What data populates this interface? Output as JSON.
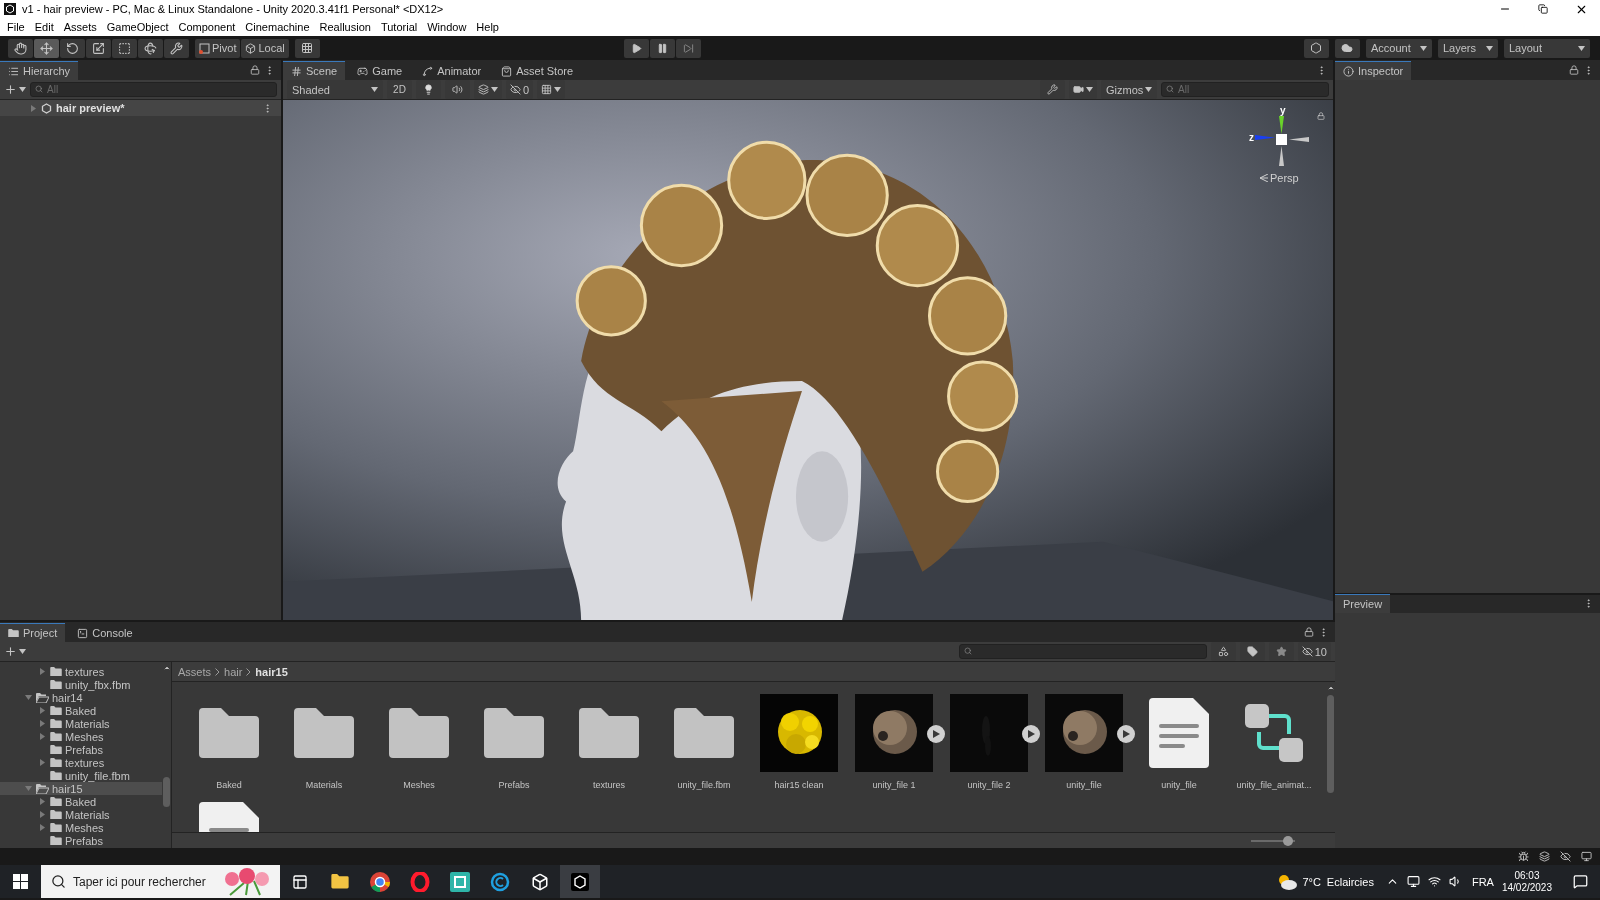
{
  "window": {
    "title": "v1 - hair preview - PC, Mac & Linux Standalone - Unity 2020.3.41f1 Personal* <DX12>"
  },
  "menu": [
    "File",
    "Edit",
    "Assets",
    "GameObject",
    "Component",
    "Cinemachine",
    "Reallusion",
    "Tutorial",
    "Window",
    "Help"
  ],
  "toolbar": {
    "tools": [
      {
        "kind": "hand",
        "selected": false
      },
      {
        "kind": "move",
        "selected": true
      },
      {
        "kind": "rotate",
        "selected": false
      },
      {
        "kind": "scale",
        "selected": false
      },
      {
        "kind": "rect",
        "selected": false
      },
      {
        "kind": "transform",
        "selected": false
      },
      {
        "kind": "custom",
        "selected": false
      }
    ],
    "pivot": "Pivot",
    "space": "Local",
    "dropdowns": [
      "Account",
      "Layers",
      "Layout"
    ]
  },
  "hierarchy": {
    "title": "Hierarchy",
    "search": {
      "placeholder": "All"
    },
    "items": [
      {
        "label": "hair preview*",
        "expanded": false
      }
    ]
  },
  "scene": {
    "tabs": [
      {
        "kind": "scene",
        "label": "Scene",
        "selected": true
      },
      {
        "kind": "game",
        "label": "Game",
        "selected": false
      },
      {
        "kind": "animator",
        "label": "Animator",
        "selected": false
      },
      {
        "kind": "store",
        "label": "Asset Store",
        "selected": false
      }
    ],
    "shading": "Shaded",
    "mode": "2D",
    "hidden_count": "0",
    "gizmos": "Gizmos",
    "search": {
      "placeholder": "All"
    },
    "axes": [
      "y",
      "z"
    ],
    "projection": "Persp"
  },
  "inspector": {
    "title": "Inspector",
    "preview": "Preview"
  },
  "project": {
    "tabs": [
      {
        "kind": "project",
        "label": "Project",
        "selected": true
      },
      {
        "kind": "console",
        "label": "Console",
        "selected": false
      }
    ],
    "hidden_count": "10",
    "tree": [
      {
        "children": [
          {
            "label": "textures",
            "expanded": false,
            "selected": false
          },
          {
            "label": "unity_fbx.fbm",
            "selected": false
          }
        ]
      },
      {
        "label": "hair14",
        "expanded": true,
        "selected": false,
        "children": [
          {
            "label": "Baked",
            "expanded": false,
            "selected": false
          },
          {
            "label": "Materials",
            "expanded": false,
            "selected": false
          },
          {
            "label": "Meshes",
            "expanded": false,
            "selected": false
          },
          {
            "label": "Prefabs",
            "selected": false
          },
          {
            "label": "textures",
            "expanded": false,
            "selected": false
          },
          {
            "label": "unity_file.fbm",
            "selected": false
          }
        ]
      },
      {
        "label": "hair15",
        "expanded": true,
        "selected": true,
        "children": [
          {
            "label": "Baked",
            "expanded": false,
            "selected": false
          },
          {
            "label": "Materials",
            "expanded": false,
            "selected": false
          },
          {
            "label": "Meshes",
            "expanded": false,
            "selected": false
          },
          {
            "label": "Prefabs",
            "selected": false
          }
        ]
      }
    ],
    "breadcrumb": [
      "Assets",
      "hair",
      "hair15"
    ],
    "assets": [
      {
        "kind": "folder",
        "label": "Baked"
      },
      {
        "kind": "folder",
        "label": "Materials"
      },
      {
        "kind": "folder",
        "label": "Meshes"
      },
      {
        "kind": "folder",
        "label": "Prefabs"
      },
      {
        "kind": "folder",
        "label": "textures"
      },
      {
        "kind": "folder",
        "label": "unity_file.fbm"
      },
      {
        "kind": "mesh",
        "label": "hair15 clean"
      },
      {
        "kind": "model",
        "label": "unity_file 1"
      },
      {
        "kind": "model",
        "label": "unity_file 2"
      },
      {
        "kind": "model",
        "label": "unity_file"
      },
      {
        "kind": "document",
        "label": "unity_file"
      },
      {
        "kind": "animator",
        "label": "unity_file_animat..."
      },
      {
        "kind": "document"
      }
    ],
    "size_slider": {
      "level": 0.85
    }
  },
  "taskbar": {
    "search": {
      "placeholder": "Taper ici pour rechercher"
    },
    "temperature": "7°C",
    "weather": "Eclaircies",
    "language": "FRA",
    "time": "06:03",
    "date": "14/02/2023"
  }
}
